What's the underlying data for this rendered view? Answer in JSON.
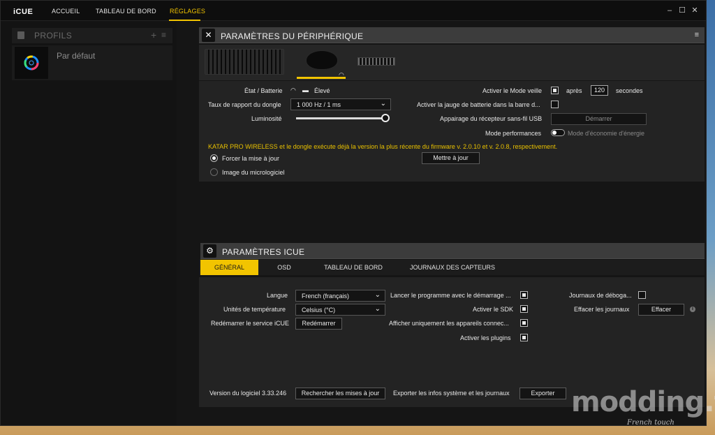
{
  "app": {
    "name": "iCUE"
  },
  "nav": {
    "home": "ACCUEIL",
    "dashboard": "TABLEAU DE BORD",
    "settings": "RÉGLAGES"
  },
  "window_controls": {
    "minimize": "–",
    "maximize": "☐",
    "close": "✕"
  },
  "profiles": {
    "title": "PROFILS",
    "items": [
      {
        "name": "Par défaut"
      }
    ]
  },
  "device_panel": {
    "title": "PARAMÈTRES DU PÉRIPHÉRIQUE",
    "status_label": "État / Batterie",
    "battery_value": "Élevé",
    "dongle_rate_label": "Taux de rapport du dongle",
    "dongle_rate_value": "1 000 Hz / 1 ms",
    "brightness_label": "Luminosité",
    "brightness_level": 1.0,
    "sleep_label": "Activer le Mode veille",
    "after_label": "après",
    "sleep_seconds": "120",
    "seconds_label": "secondes",
    "battery_gauge_label": "Activer la jauge de batterie dans la barre d...",
    "pairing_label": "Appairage du récepteur sans-fil USB",
    "pairing_button": "Démarrer",
    "performance_label": "Mode performances",
    "eco_label": "Mode d'économie d'énergie",
    "firmware_message": "KATAR PRO WIRELESS et le dongle exécute déjà la version la plus récente du firmware v. 2.0.10 et v. 2.0.8, respectivement.",
    "force_update_label": "Forcer la mise à jour",
    "firmware_image_label": "Image du micrologiciel",
    "update_button": "Mettre à jour"
  },
  "icue_panel": {
    "title": "PARAMÈTRES ICUE",
    "tabs": [
      "GÉNÉRAL",
      "OSD",
      "TABLEAU DE BORD",
      "JOURNAUX DES CAPTEURS"
    ],
    "language_label": "Langue",
    "language_value": "French (français)",
    "temp_label": "Unités de température",
    "temp_value": "Celsius (°C)",
    "restart_label": "Redémarrer le service iCUE",
    "restart_button": "Redémarrer",
    "launch_label": "Lancer le programme avec le démarrage ...",
    "sdk_label": "Activer le SDK",
    "connected_only_label": "Afficher uniquement les appareils connec...",
    "plugins_label": "Activer les plugins",
    "debug_logs_label": "Journaux de déboga...",
    "clear_logs_label": "Effacer les journaux",
    "clear_button": "Effacer",
    "version_label": "Version du logiciel 3.33.246",
    "check_updates_button": "Rechercher les mises à jour",
    "export_label": "Exporter les infos système et les journaux",
    "export_button": "Exporter"
  },
  "watermark": {
    "brand": "modding.fr",
    "tagline": "French touch"
  },
  "colors": {
    "accent": "#f2c400",
    "background": "#151515",
    "panel": "#232323",
    "header": "#3c3c3c"
  }
}
